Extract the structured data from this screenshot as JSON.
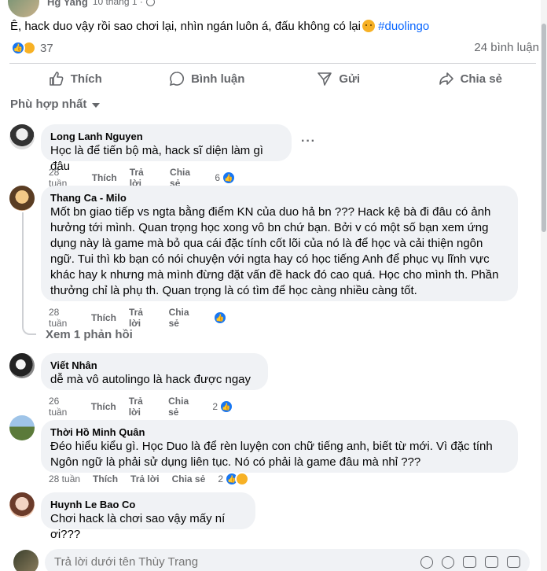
{
  "post": {
    "author": "Hg Yang",
    "date": "10 tháng 1",
    "text": "Ê, hack duo vậy rồi sao chơi lại, nhìn ngán luôn á, đấu không có lại",
    "hashtag": "#duolingo",
    "reaction_count": "37",
    "comment_count": "24 bình luận"
  },
  "actions": {
    "like": "Thích",
    "comment": "Bình luận",
    "send": "Gửi",
    "share": "Chia sẻ"
  },
  "sort_label": "Phù hợp nhất",
  "comments": [
    {
      "name": "Long Lanh Nguyen",
      "text": "Học là để tiến bộ mà, hack sĩ diện làm gì đâu",
      "time": "28 tuần",
      "like": "Thích",
      "reply": "Trả lời",
      "share": "Chia sẻ",
      "reactions": "6"
    },
    {
      "name": "Thang Ca - Milo",
      "text": "Mốt bn giao tiếp vs ngta bằng điểm KN của duo hả bn ??? Hack kệ bà đi đâu có ảnh hưởng tới mình. Quan trọng học xong vô bn chứ bạn. Bởi v có một số bạn xem ứng dụng này là game mà bỏ qua cái đặc tính cốt lõi của nó là để học và cải thiện ngôn ngữ. Tui thì kb bạn có nói chuyện với ngta hay có học tiếng Anh để phục vụ lĩnh vực khác hay k nhưng mà mình đừng đặt vấn đề hack đó cao quá. Học cho mình th. Phần thưởng chỉ là phụ th. Quan trọng là có tìm để học càng nhiều càng tốt.",
      "time": "28 tuần",
      "like": "Thích",
      "reply": "Trả lời",
      "share": "Chia sẻ",
      "reactions": "",
      "see_replies": "Xem 1 phản hồi"
    },
    {
      "name": "Viết Nhân",
      "text": "dễ mà vô autolingo là hack được ngay",
      "time": "26 tuần",
      "like": "Thích",
      "reply": "Trả lời",
      "share": "Chia sẻ",
      "reactions": "2"
    },
    {
      "name": "Thời Hồ Minh Quân",
      "text": "Đéo hiểu kiểu gì. Học Duo là để rèn luyện con chữ tiếng anh, biết từ mới. Vì đặc tính Ngôn ngữ là phải sử dụng liên tục. Nó có phải là game đâu mà nhỉ ???",
      "time": "28 tuần",
      "like": "Thích",
      "reply": "Trả lời",
      "share": "Chia sẻ",
      "reactions": "2"
    },
    {
      "name": "Huynh Le Bao Co",
      "text": "Chơi hack là chơi sao vậy mấy ní ơi???"
    }
  ],
  "reply_box": {
    "placeholder": "Trả lời dưới tên Thùy Trang"
  },
  "colors": {
    "accent": "#1877f2",
    "hashtag": "#0866ff",
    "bubble": "#f0f2f5",
    "muted": "#65676b"
  }
}
